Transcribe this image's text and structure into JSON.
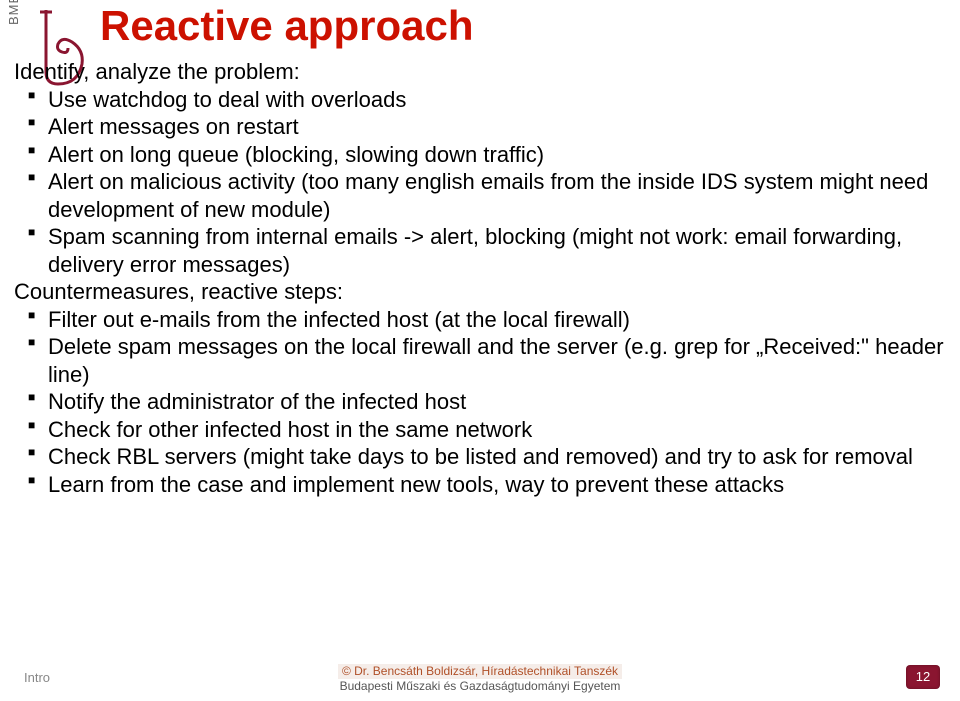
{
  "header": {
    "bme": "BME",
    "title": "Reactive approach"
  },
  "section1": {
    "head": "Identify, analyze the problem:",
    "items": [
      "Use watchdog to deal with overloads",
      "Alert messages on restart",
      "Alert on long queue (blocking, slowing down traffic)",
      "Alert on malicious activity (too many english emails from the inside IDS system might need development of new module)",
      "Spam scanning from internal emails -> alert, blocking (might not work: email forwarding, delivery error messages)"
    ]
  },
  "section2": {
    "head": "Countermeasures, reactive steps:",
    "items": [
      "Filter out e-mails from the infected host (at the local firewall)",
      "Delete spam messages on the local firewall and the server (e.g. grep for „Received:\" header line)",
      "Notify the administrator of the infected host",
      "Check for other infected host in the same network",
      "Check RBL servers (might take days to be listed and removed) and try to ask for removal",
      "Learn from the case and implement new tools, way to prevent these attacks"
    ]
  },
  "footer": {
    "left": "Intro",
    "center1": "© Dr. Bencsáth Boldizsár, Híradástechnikai Tanszék",
    "center2": "Budapesti Műszaki és Gazdaságtudományi Egyetem",
    "page": "12"
  }
}
